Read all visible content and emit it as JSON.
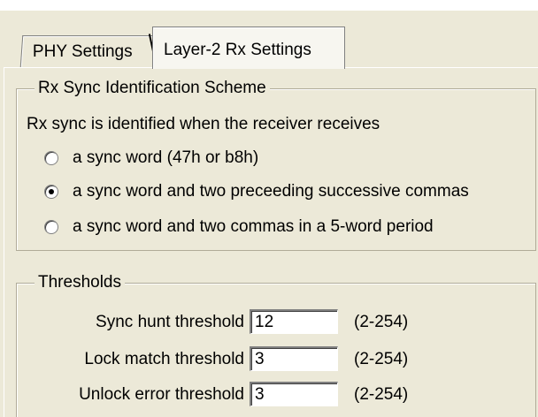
{
  "tabs": [
    {
      "label": "PHY Settings",
      "active": false
    },
    {
      "label": "Layer-2 Rx Settings",
      "active": true
    }
  ],
  "sync_group": {
    "legend": "Rx Sync Identification Scheme",
    "intro": "Rx sync is identified when the receiver receives",
    "options": [
      {
        "label": "a sync word (47h or b8h)",
        "checked": false
      },
      {
        "label": "a sync word and two preceeding successive commas",
        "checked": true
      },
      {
        "label": "a sync word and two commas in a 5-word period",
        "checked": false
      }
    ]
  },
  "thresholds": {
    "legend": "Thresholds",
    "rows": [
      {
        "label": "Sync hunt threshold",
        "value": "12",
        "range": "(2-254)"
      },
      {
        "label": "Lock match threshold",
        "value": "3",
        "range": "(2-254)"
      },
      {
        "label": "Unlock error threshold",
        "value": "3",
        "range": "(2-254)"
      }
    ]
  }
}
